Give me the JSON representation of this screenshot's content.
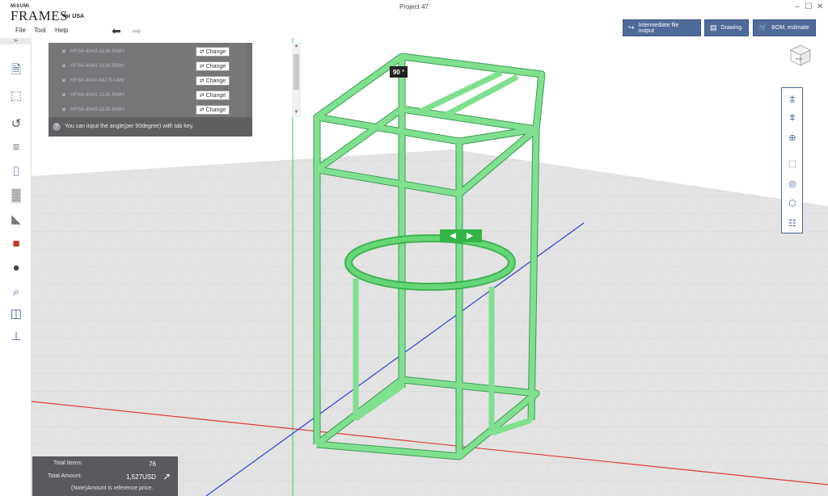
{
  "app": {
    "logo_brand": "MiSUMi",
    "logo_name": "FRAMES",
    "logo_region": "for USA",
    "project_title": "Project 47"
  },
  "window_controls": {
    "minimize": "–",
    "maximize": "☐",
    "close": "✕"
  },
  "menu": {
    "items": [
      "File",
      "Tool",
      "Help"
    ]
  },
  "toolbar": {
    "undo_icon": "undo-arrow",
    "redo_icon": "redo-arrow",
    "buttons": [
      {
        "label": "Intermediate file output",
        "icon": "export-icon"
      },
      {
        "label": "Drawing",
        "icon": "drawing-icon"
      },
      {
        "label": "BOM, estimate",
        "icon": "cart-icon"
      }
    ]
  },
  "sidebar": {
    "collapse_label": "≫",
    "tools": [
      "file-icon",
      "parts-import-icon",
      "history-icon",
      "frame-icon",
      "panel-icon",
      "grille-icon",
      "bracket-icon",
      "fitting-icon",
      "caster-icon",
      "search-icon",
      "door-icon",
      "foot-icon"
    ]
  },
  "parts_panel": {
    "items": [
      {
        "name": "HFS8-4040-1126-RMH",
        "button": "Change"
      },
      {
        "name": "HFS8-4040-1126-RMH",
        "button": "Change"
      },
      {
        "name": "HFS8-4040-647.5-LMV",
        "button": "Change"
      },
      {
        "name": "HFS8-4040-1126-RMH",
        "button": "Change"
      },
      {
        "name": "HFS8-4040-1126-RMH",
        "button": "Change"
      }
    ],
    "hint": "You can input the angle(per 90degree) with tab key."
  },
  "viewport": {
    "angle_label": "90 °",
    "view_cube_label": "front",
    "frame_color": "#6ed184",
    "ring_color": "#4fc45f"
  },
  "view_tools": [
    "fit-all-icon",
    "fit-selection-icon",
    "zoom-icon",
    "frame-select-icon",
    "rotate-view-icon",
    "view-cube-icon",
    "settings-list-icon"
  ],
  "summary": {
    "total_items_label": "Total Items:",
    "total_items_value": "76",
    "total_amount_label": "Total Amount:",
    "total_amount_value": "1,527USD",
    "note": "(Note)Amount is reference price."
  }
}
